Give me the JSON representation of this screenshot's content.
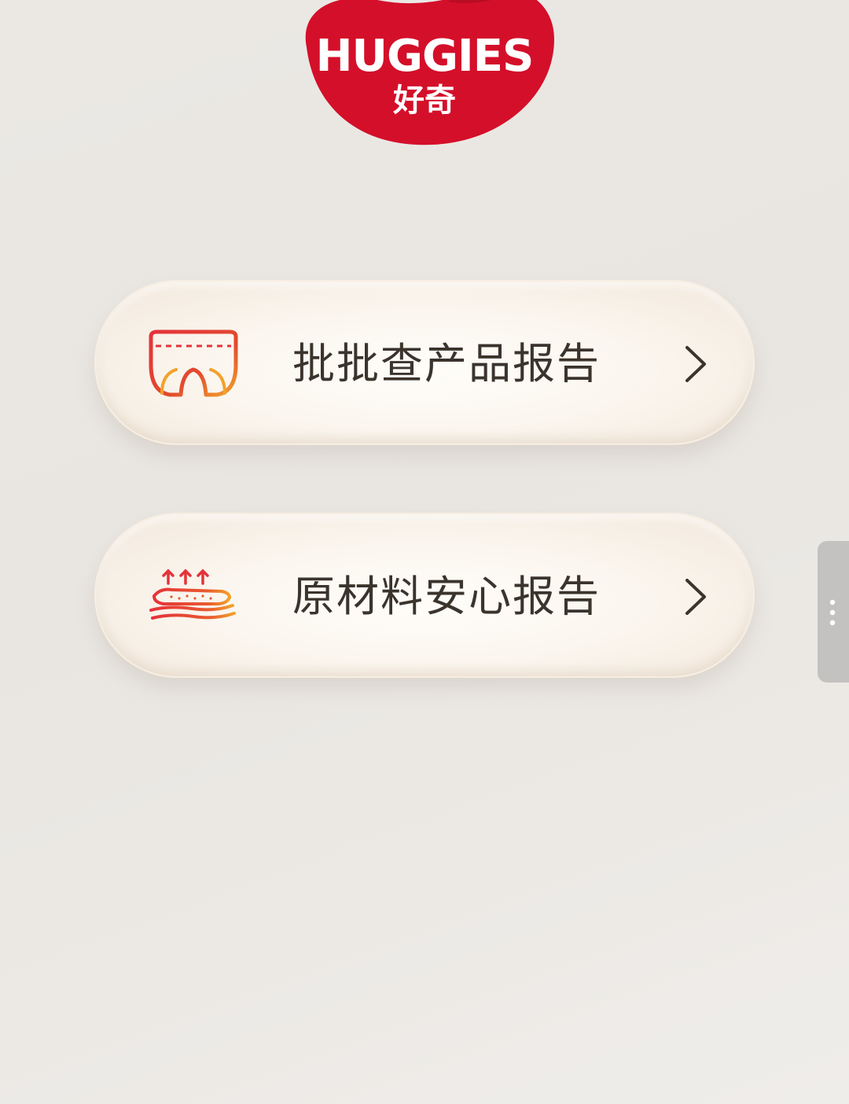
{
  "brand": {
    "name_en": "HUGGIES",
    "name_cn": "好奇",
    "primary_color": "#d40f2a"
  },
  "menu": {
    "items": [
      {
        "label": "批批查产品报告",
        "icon": "diaper-icon"
      },
      {
        "label": "原材料安心报告",
        "icon": "breathable-layers-icon"
      }
    ]
  },
  "side_handle": {
    "icon": "more-vertical-icon"
  }
}
